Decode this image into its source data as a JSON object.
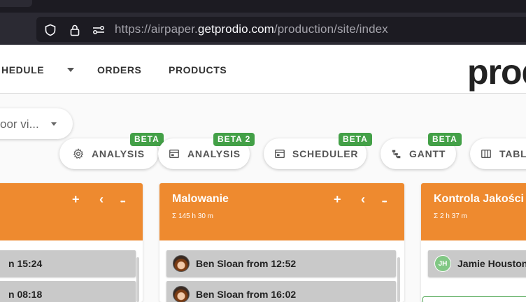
{
  "browser": {
    "url_prefix": "https://airpaper.",
    "url_domain": "getprodio.com",
    "url_path": "/production/site/index"
  },
  "nav": {
    "schedule": "HEDULE",
    "orders": "ORDERS",
    "products": "PRODUCTS",
    "logo": "prod"
  },
  "view_select": {
    "value": "oor vi..."
  },
  "pills": [
    {
      "label": "ANALYSIS",
      "badge": "BETA",
      "icon": "gear-icon"
    },
    {
      "label": "ANALYSIS",
      "badge": "BETA 2",
      "icon": "calendar-icon"
    },
    {
      "label": "SCHEDULER",
      "badge": "BETA",
      "icon": "calendar-icon"
    },
    {
      "label": "GANTT",
      "badge": "BETA",
      "icon": "gantt-icon"
    },
    {
      "label": "TABL",
      "badge": "",
      "icon": "table-icon"
    }
  ],
  "columns": [
    {
      "title": "",
      "sum": "",
      "actions": {
        "add": "+",
        "collapse": "‹",
        "more": "•••"
      },
      "cards": [
        {
          "text": "n 15:24"
        },
        {
          "text": "n 08:18"
        }
      ]
    },
    {
      "title": "Malowanie",
      "sum": "Σ 145 h 30 m",
      "actions": {
        "add": "+",
        "collapse": "‹",
        "more": "•••"
      },
      "cards": [
        {
          "text": "Ben Sloan from 12:52"
        },
        {
          "text": "Ben Sloan from 16:02"
        }
      ]
    },
    {
      "title": "Kontrola Jakości",
      "sum": "Σ 2 h 37 m",
      "cards": [
        {
          "text": "Jamie Houston",
          "initials": "JH"
        }
      ]
    }
  ],
  "colors": {
    "column_header": "#ee8a2f",
    "beta_badge": "#43a047",
    "card_bg": "#c9c9c9"
  }
}
